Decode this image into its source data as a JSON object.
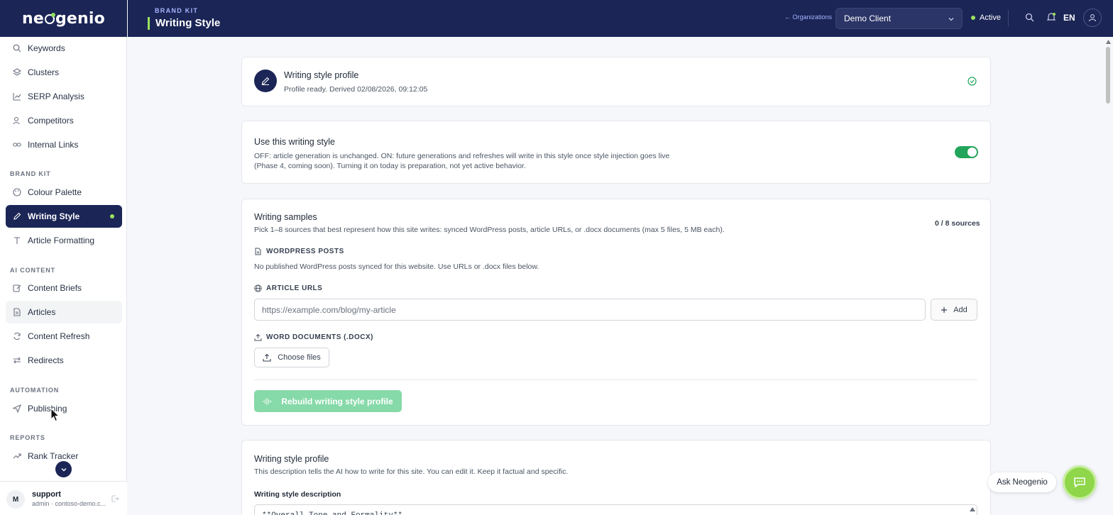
{
  "app": {
    "brand": "neogenio"
  },
  "sidebar": {
    "items_top": [
      {
        "label": "Keywords",
        "icon": "search-icon"
      },
      {
        "label": "Clusters",
        "icon": "layers-icon"
      },
      {
        "label": "SERP Analysis",
        "icon": "line-chart-icon"
      },
      {
        "label": "Competitors",
        "icon": "users-icon"
      },
      {
        "label": "Internal Links",
        "icon": "link-icon"
      }
    ],
    "brand_kit": {
      "label": "BRAND KIT",
      "items": [
        {
          "label": "Colour Palette",
          "icon": "palette-icon"
        },
        {
          "label": "Writing Style",
          "icon": "pen-icon",
          "active": true
        },
        {
          "label": "Article Formatting",
          "icon": "type-icon"
        }
      ]
    },
    "ai_content": {
      "label": "AI CONTENT",
      "items": [
        {
          "label": "Content Briefs",
          "icon": "edit-doc-icon"
        },
        {
          "label": "Articles",
          "icon": "document-icon",
          "hovered": true
        },
        {
          "label": "Content Refresh",
          "icon": "refresh-icon"
        },
        {
          "label": "Redirects",
          "icon": "redirect-icon"
        }
      ]
    },
    "automation": {
      "label": "AUTOMATION",
      "items": [
        {
          "label": "Publishing",
          "icon": "send-icon"
        }
      ]
    },
    "reports": {
      "label": "REPORTS",
      "items": [
        {
          "label": "Rank Tracker",
          "icon": "trending-icon"
        }
      ]
    },
    "user": {
      "initial": "M",
      "name": "support",
      "meta": "admin · contoso-demo.c..."
    }
  },
  "header": {
    "crumb": "BRAND KIT",
    "title": "Writing Style",
    "org_link": "← Organizations",
    "org_selected": "Demo Client",
    "status": "Active",
    "lang": "EN"
  },
  "profile_status": {
    "title": "Writing style profile",
    "subtitle": "Profile ready. Derived 02/08/2026, 09:12:05"
  },
  "use_style": {
    "title": "Use this writing style",
    "desc_line1": "OFF: article generation is unchanged. ON: future generations and refreshes will write in this style once style injection goes live",
    "desc_line2": "(Phase 4, coming soon). Turning it on today is preparation, not yet active behavior.",
    "enabled": true
  },
  "samples": {
    "title": "Writing samples",
    "desc": "Pick 1–8 sources that best represent how this site writes: synced WordPress posts, article URLs, or .docx documents (max 5 files, 5 MB each).",
    "count": "0 / 8 sources",
    "wordpress_label": "WORDPRESS POSTS",
    "wordpress_empty": "No published WordPress posts synced for this website. Use URLs or .docx files below.",
    "urls_label": "ARTICLE URLS",
    "url_placeholder": "https://example.com/blog/my-article",
    "add_label": "Add",
    "docx_label": "WORD DOCUMENTS (.DOCX)",
    "choose_label": "Choose files",
    "rebuild_label": "Rebuild writing style profile"
  },
  "profile_editor": {
    "title": "Writing style profile",
    "desc": "This description tells the AI how to write for this site. You can edit it. Keep it factual and specific.",
    "field_label": "Writing style description",
    "field_value": "**Overall Tone and Formality**"
  },
  "assistant": {
    "label": "Ask Neogenio"
  },
  "colors": {
    "navy": "#1b2556",
    "lime": "#9be15d",
    "green": "#22a55b"
  }
}
